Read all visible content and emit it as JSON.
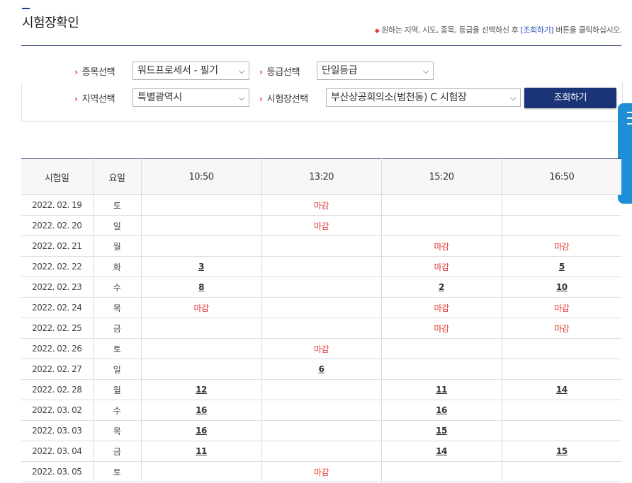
{
  "header": {
    "title": "시험장확인",
    "notice_pre": "원하는 지역, 시도, 종목, 등급을 선택하신 후",
    "notice_btn": "[조회하기]",
    "notice_post": "버튼을 클릭하십시오."
  },
  "filters": {
    "subject_label": "종목선택",
    "subject_value": "워드프로세서 - 필기",
    "grade_label": "등급선택",
    "grade_value": "단일등급",
    "region_label": "지역선택",
    "region_value": "특별광역시",
    "center_label": "시험장선택",
    "center_value": "부산상공회의소(범천동) C 시험장",
    "search_button": "조회하기"
  },
  "table": {
    "headers": [
      "시험일",
      "요일",
      "10:50",
      "13:20",
      "15:20",
      "16:50"
    ],
    "rows": [
      [
        "2022. 02. 19",
        "토",
        "",
        "마감",
        "",
        ""
      ],
      [
        "2022. 02. 20",
        "일",
        "",
        "마감",
        "",
        ""
      ],
      [
        "2022. 02. 21",
        "월",
        "",
        "",
        "마감",
        "마감"
      ],
      [
        "2022. 02. 22",
        "화",
        "3",
        "",
        "마감",
        "5"
      ],
      [
        "2022. 02. 23",
        "수",
        "8",
        "",
        "2",
        "10"
      ],
      [
        "2022. 02. 24",
        "목",
        "마감",
        "",
        "마감",
        "마감"
      ],
      [
        "2022. 02. 25",
        "금",
        "",
        "",
        "마감",
        "마감"
      ],
      [
        "2022. 02. 26",
        "토",
        "",
        "마감",
        "",
        ""
      ],
      [
        "2022. 02. 27",
        "일",
        "",
        "6",
        "",
        ""
      ],
      [
        "2022. 02. 28",
        "월",
        "12",
        "",
        "11",
        "14"
      ],
      [
        "2022. 03. 02",
        "수",
        "16",
        "",
        "16",
        ""
      ],
      [
        "2022. 03. 03",
        "목",
        "16",
        "",
        "15",
        ""
      ],
      [
        "2022. 03. 04",
        "금",
        "11",
        "",
        "14",
        "15"
      ],
      [
        "2022. 03. 05",
        "토",
        "",
        "마감",
        "",
        ""
      ]
    ]
  },
  "colors": {
    "accent": "#1b3478",
    "closed": "#e53935",
    "side_tab": "#1e8fd6"
  }
}
